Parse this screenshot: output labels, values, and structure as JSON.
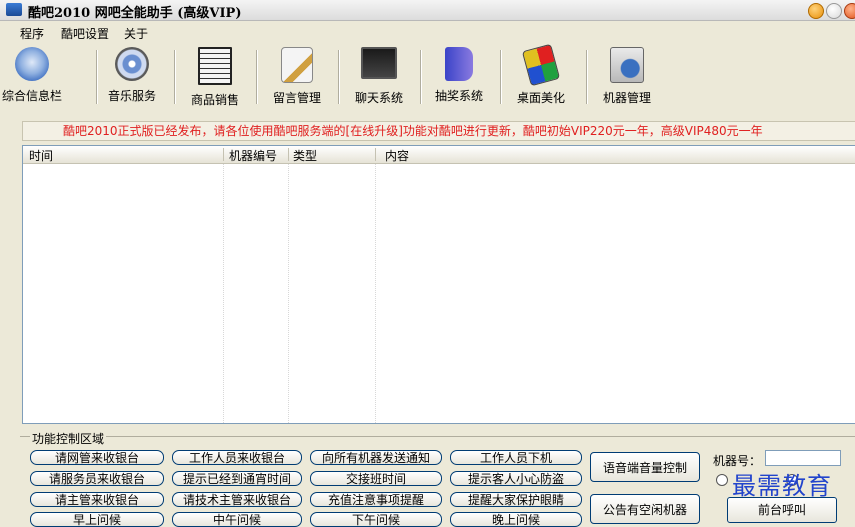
{
  "window": {
    "title": "酷吧2010 网吧全能助手 (高级VIP)"
  },
  "menu": {
    "items": [
      "程序",
      "酷吧设置",
      "关于"
    ]
  },
  "toolbar": {
    "items": [
      {
        "label": "综合信息栏",
        "icon": "info-gear-icon"
      },
      {
        "label": "音乐服务",
        "icon": "music-disc-icon"
      },
      {
        "label": "商品销售",
        "icon": "calculator-icon"
      },
      {
        "label": "留言管理",
        "icon": "message-pencil-icon"
      },
      {
        "label": "聊天系统",
        "icon": "chat-monitor-icon"
      },
      {
        "label": "抽奖系统",
        "icon": "lottery-ball-icon"
      },
      {
        "label": "桌面美化",
        "icon": "desktop-paint-icon"
      },
      {
        "label": "机器管理",
        "icon": "computer-manage-icon"
      }
    ]
  },
  "notice": "酷吧2010正式版已经发布，请各位使用酷吧服务端的[在线升级]功能对酷吧进行更新，酷吧初始VIP220元一年，高级VIP480元一年",
  "table": {
    "columns": [
      "时间",
      "机器编号",
      "类型",
      "内容"
    ],
    "rows": []
  },
  "controls": {
    "group_title": "功能控制区域",
    "buttons": [
      [
        "请网管来收银台",
        "工作人员来收银台",
        "向所有机器发送通知",
        "工作人员下机"
      ],
      [
        "请服务员来收银台",
        "提示已经到通宵时间",
        "交接班时间",
        "提示客人小心防盗"
      ],
      [
        "请主管来收银台",
        "请技术主管来收银台",
        "充值注意事项提醒",
        "提醒大家保护眼睛"
      ],
      [
        "早上问候",
        "中午问候",
        "下午问候",
        "晚上问候"
      ]
    ],
    "volume_button": "语音端音量控制",
    "idle_button": "公告有空闲机器",
    "machine_label": "机器号：",
    "machine_value": "",
    "front_call": "前台呼叫"
  },
  "watermark": "最需教育"
}
